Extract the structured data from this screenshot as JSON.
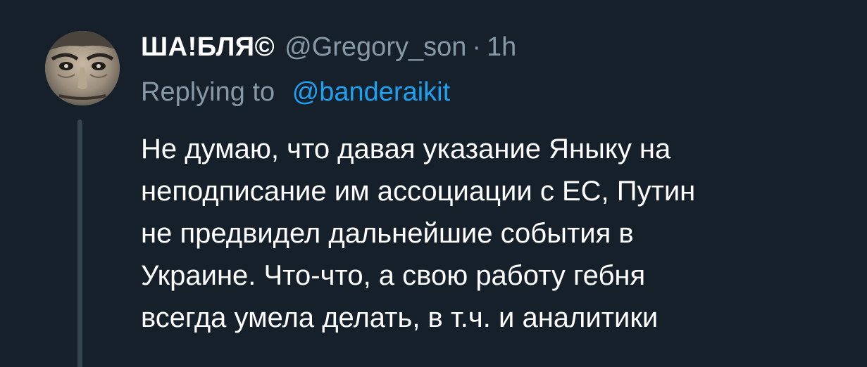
{
  "tweet": {
    "display_name": "ША!БЛЯ©",
    "handle": "@Gregory_son",
    "separator": "·",
    "time": "1h",
    "replying_label": "Replying to",
    "replying_handle": "@banderaikit",
    "body_lines": [
      "Не думаю, что давая указание Яныку на",
      "неподписание им ассоциации с ЕС, Путин",
      "не предвидел дальнейшие события в",
      "Украине. Что-что, а свою работу гебня",
      "всегда умела делать, в т.ч. и аналитики"
    ]
  },
  "colors": {
    "background": "#15202b",
    "primary_text": "#ffffff",
    "secondary_text": "#8899a6",
    "link": "#1da1f2",
    "thread_line": "#38444d"
  }
}
